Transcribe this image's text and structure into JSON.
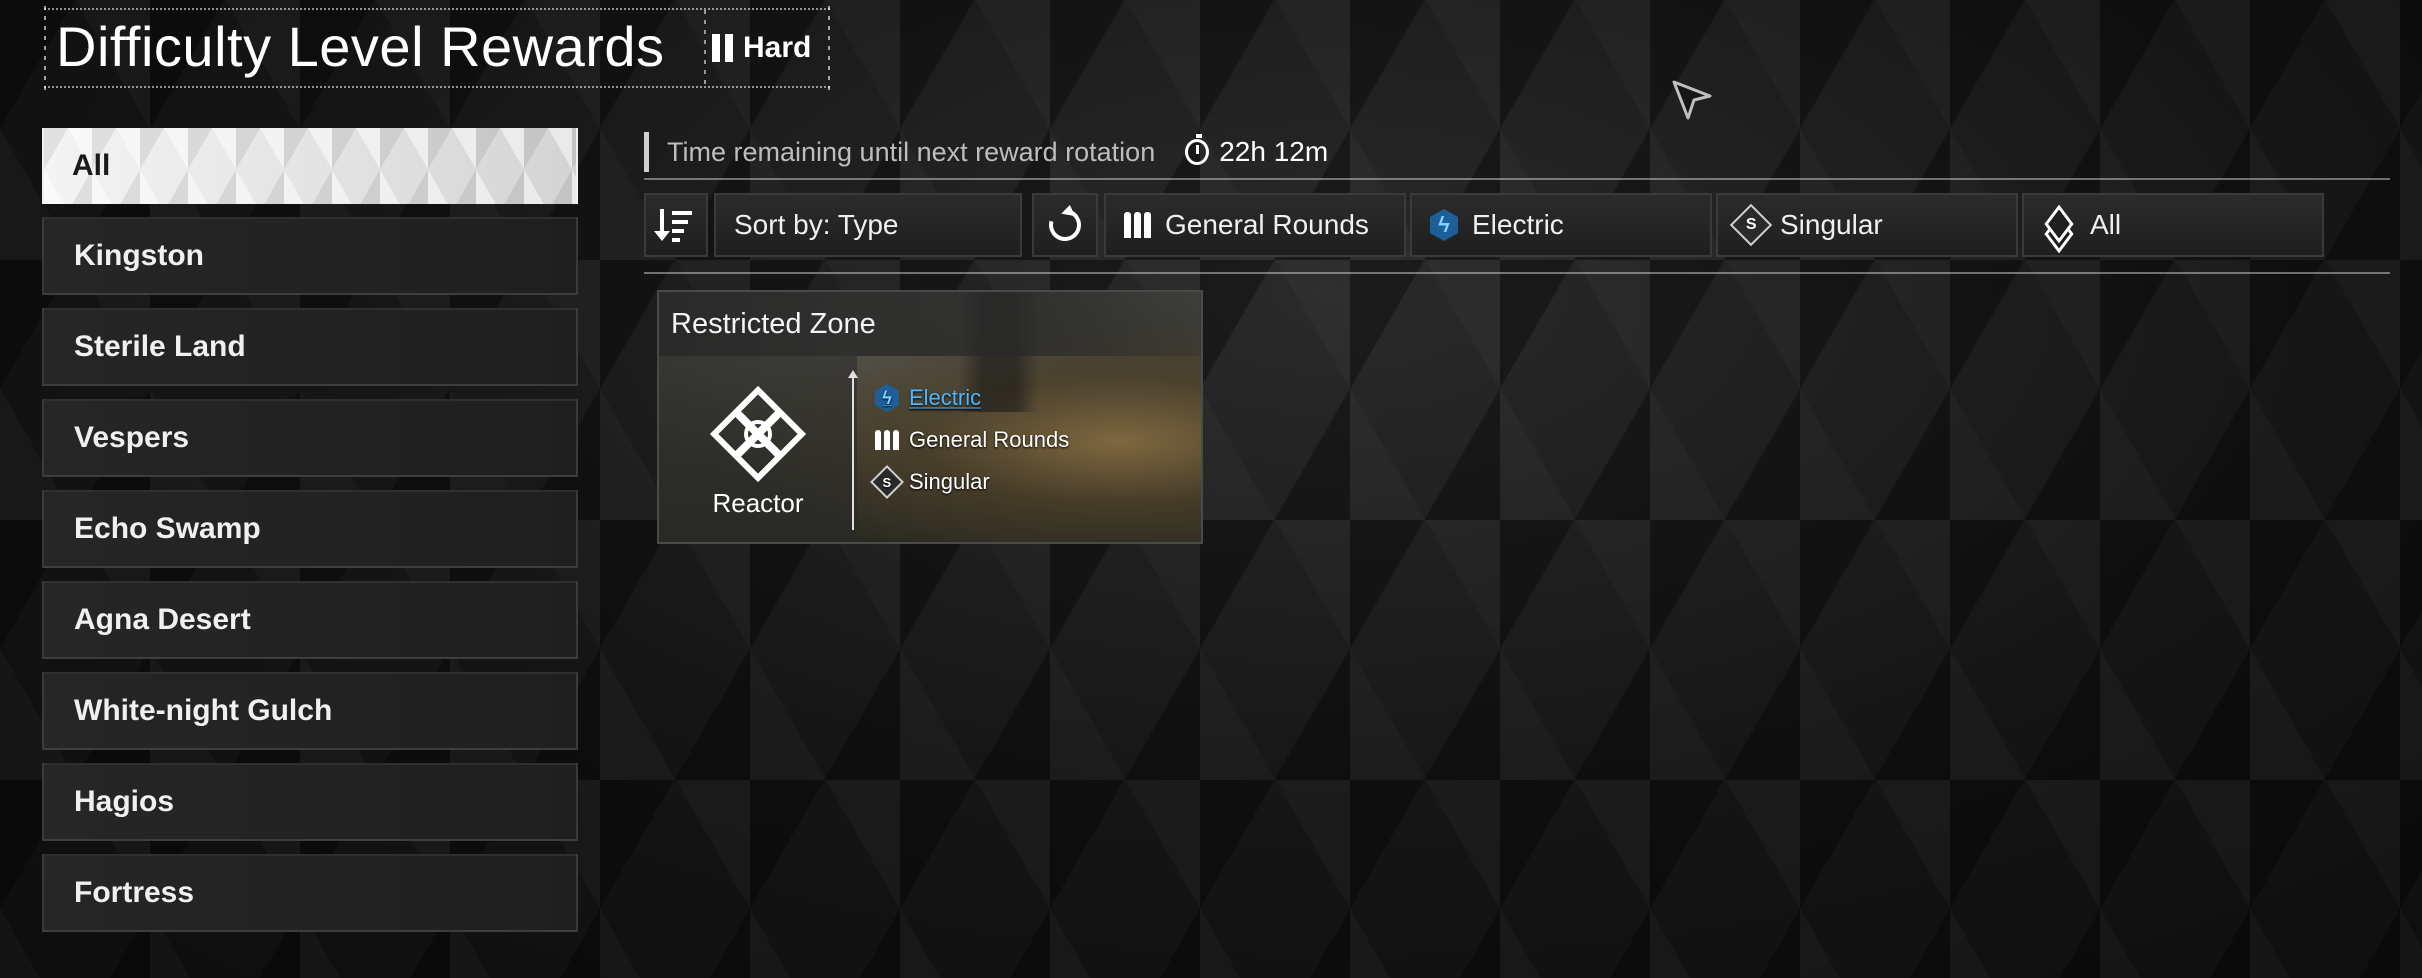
{
  "header": {
    "title": "Difficulty Level Rewards",
    "difficulty_label": "Hard"
  },
  "sidebar": {
    "items": [
      {
        "label": "All",
        "active": true
      },
      {
        "label": "Kingston",
        "active": false
      },
      {
        "label": "Sterile Land",
        "active": false
      },
      {
        "label": "Vespers",
        "active": false
      },
      {
        "label": "Echo Swamp",
        "active": false
      },
      {
        "label": "Agna Desert",
        "active": false
      },
      {
        "label": "White-night Gulch",
        "active": false
      },
      {
        "label": "Hagios",
        "active": false
      },
      {
        "label": "Fortress",
        "active": false
      }
    ]
  },
  "timer": {
    "label": "Time remaining until next reward rotation",
    "value": "22h 12m",
    "icon": "stopwatch-icon"
  },
  "filters": {
    "sort_icon": "sort-order-icon",
    "sort_label": "Sort by: Type",
    "reset_icon": "refresh-icon",
    "ammo_label": "General Rounds",
    "ammo_icon": "ammo-icon",
    "attribute_label": "Electric",
    "attribute_icon": "electric-icon",
    "tier_label": "Singular",
    "tier_icon": "singular-icon",
    "category_label": "All",
    "category_icon": "layers-icon"
  },
  "cards": [
    {
      "zone": "Restricted Zone",
      "reward_type": "Reactor",
      "reward_icon": "reactor-icon",
      "stats": [
        {
          "label": "Electric",
          "icon": "electric-icon",
          "color": "#4db8ff"
        },
        {
          "label": "General Rounds",
          "icon": "ammo-icon",
          "color": "#ffffff"
        },
        {
          "label": "Singular",
          "icon": "singular-icon",
          "color": "#ffffff"
        }
      ]
    }
  ],
  "colors": {
    "background": "#121212",
    "accent_electric": "#4db8ff",
    "active_tab": "#dadada"
  }
}
